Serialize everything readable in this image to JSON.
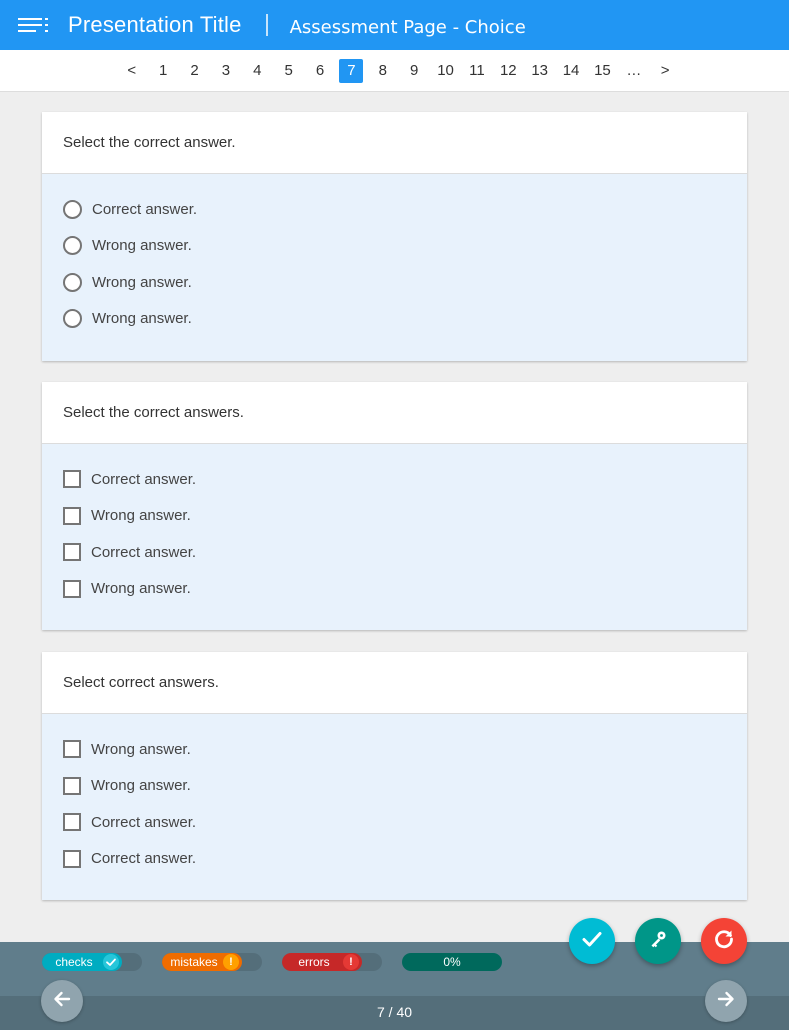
{
  "header": {
    "presentation_title": "Presentation Title",
    "page_title": "Assessment Page - Choice"
  },
  "pager": {
    "prev": "<",
    "next": ">",
    "ellipsis": "…",
    "pages": [
      "1",
      "2",
      "3",
      "4",
      "5",
      "6",
      "7",
      "8",
      "9",
      "10",
      "11",
      "12",
      "13",
      "14",
      "15"
    ],
    "active": "7"
  },
  "questions": [
    {
      "prompt": "Select the correct answer.",
      "type": "radio",
      "options": [
        "Correct answer.",
        "Wrong answer.",
        "Wrong answer.",
        "Wrong answer."
      ]
    },
    {
      "prompt": "Select the correct answers.",
      "type": "checkbox",
      "options": [
        "Correct answer.",
        "Wrong answer.",
        "Correct answer.",
        "Wrong answer."
      ]
    },
    {
      "prompt": "Select correct answers.",
      "type": "checkbox",
      "options": [
        "Wrong answer.",
        "Wrong answer.",
        "Correct answer.",
        "Correct answer."
      ]
    }
  ],
  "footer": {
    "checks_label": "checks",
    "mistakes_label": "mistakes",
    "mistakes_badge": "!",
    "errors_label": "errors",
    "errors_badge": "!",
    "progress_label": "0%",
    "progress_value": 0,
    "page_counter": "7 / 40"
  },
  "colors": {
    "primary": "#2196f3",
    "check_fab": "#00bcd4",
    "key_fab": "#009688",
    "reset_fab": "#f44336",
    "footer": "#607d8b"
  },
  "icons": {
    "menu": "menu-icon",
    "check": "check-icon",
    "key": "key-icon",
    "reset": "refresh-icon",
    "prev": "arrow-left-icon",
    "next": "arrow-right-icon"
  }
}
